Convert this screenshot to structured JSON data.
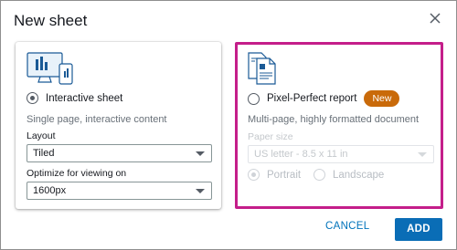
{
  "dialog": {
    "title": "New sheet"
  },
  "interactive": {
    "option_label": "Interactive sheet",
    "description": "Single page, interactive content",
    "layout_label": "Layout",
    "layout_value": "Tiled",
    "optimize_label": "Optimize for viewing on",
    "optimize_value": "1600px"
  },
  "pixel_perfect": {
    "option_label": "Pixel-Perfect report",
    "badge": "New",
    "description": "Multi-page, highly formatted document",
    "paper_size_label": "Paper size",
    "paper_size_value": "US letter - 8.5 x 11 in",
    "orientation_options": [
      "Portrait",
      "Landscape"
    ]
  },
  "actions": {
    "cancel": "CANCEL",
    "add": "ADD"
  },
  "colors": {
    "selection_border": "#c41e8a",
    "badge": "#c96a0a",
    "primary": "#0a6db6",
    "link": "#0073bb"
  }
}
